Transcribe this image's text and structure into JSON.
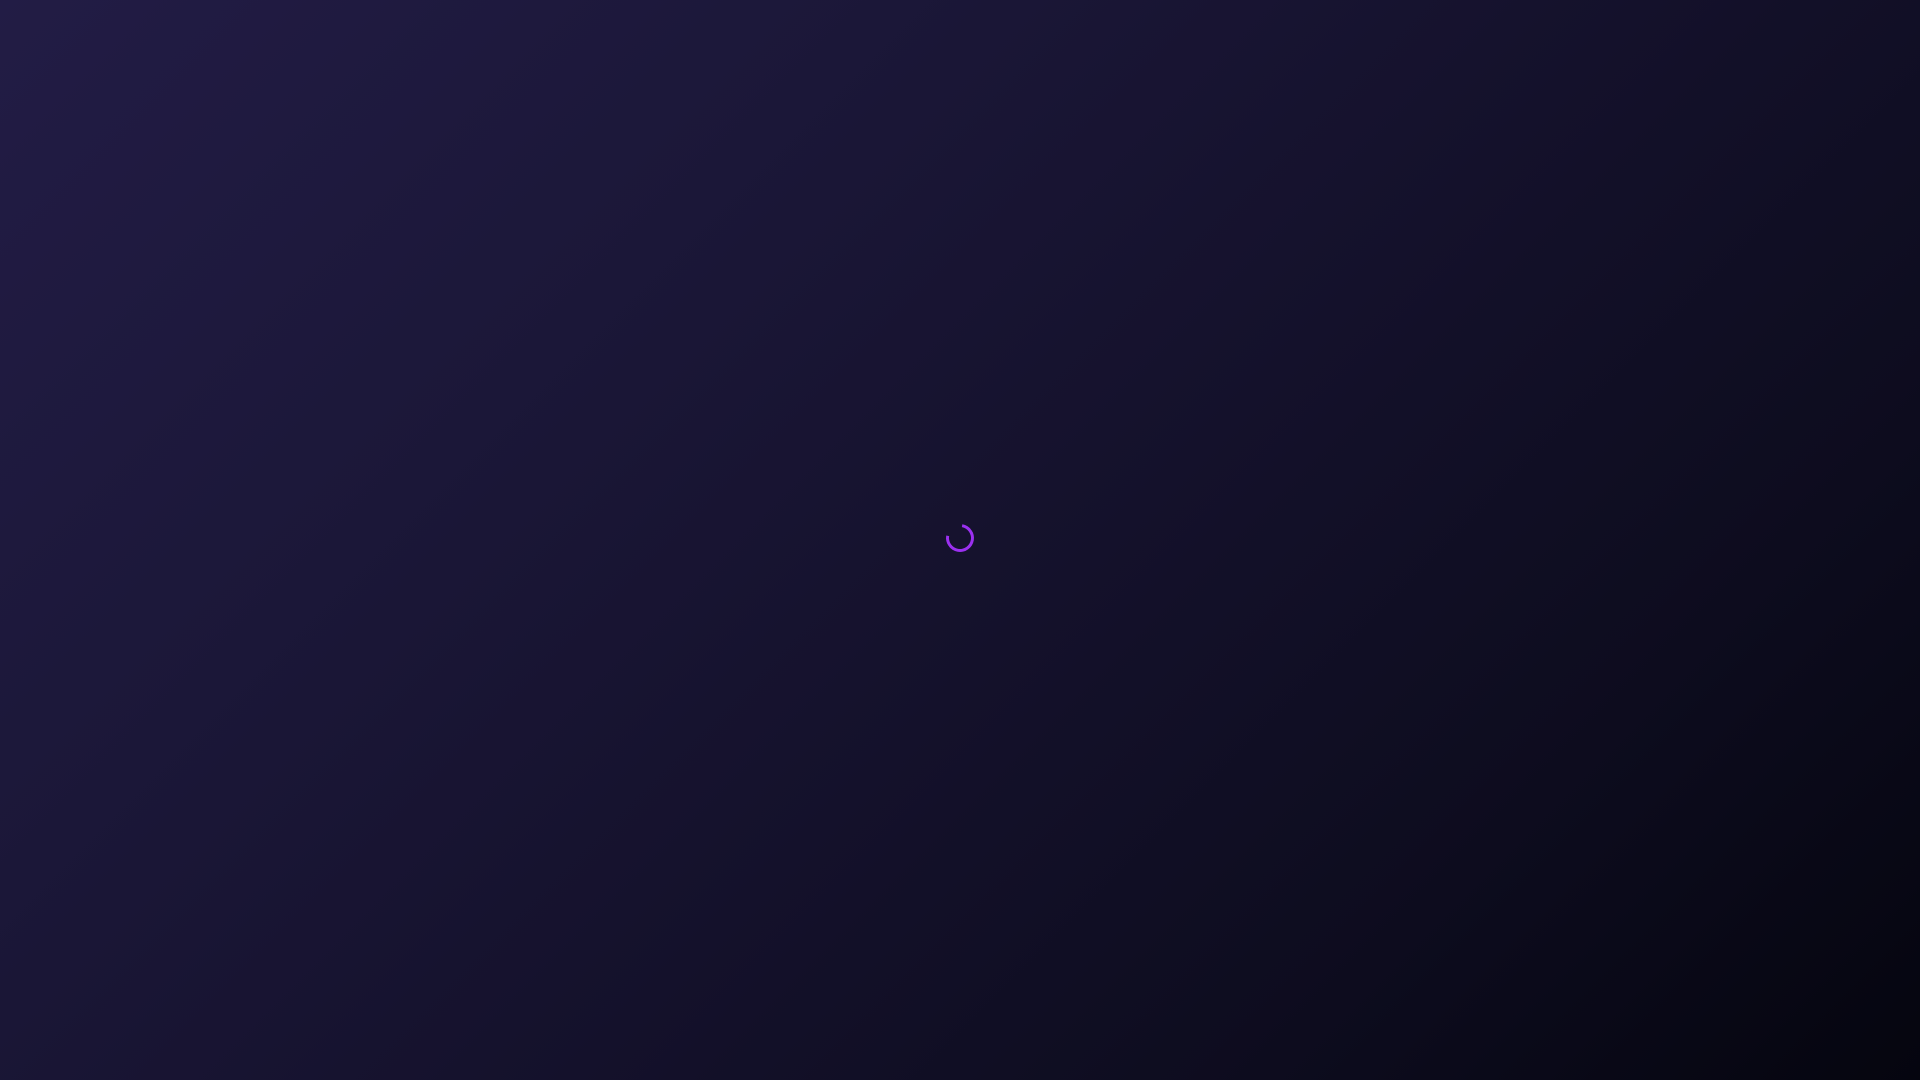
{
  "screen": {
    "state": "loading",
    "background_colors": [
      "#221c45",
      "#14112b",
      "#05050f"
    ]
  },
  "spinner": {
    "icon": "loading-spinner-icon",
    "accent_color": "#9b30f0"
  }
}
